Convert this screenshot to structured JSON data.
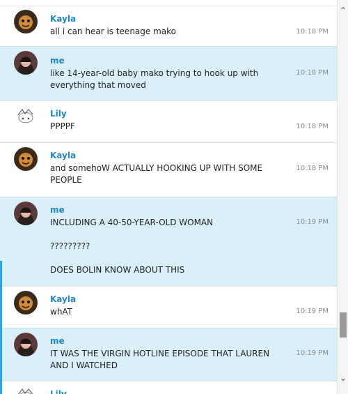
{
  "messages": [
    {
      "sender": "Kayla",
      "lines": [
        "all i can hear is teenage mako"
      ],
      "time": "10:18 PM",
      "self": false
    },
    {
      "sender": "me",
      "lines": [
        "like 14-year-old baby mako trying to hook up with everything that moved"
      ],
      "time": "10:18 PM",
      "self": true
    },
    {
      "sender": "Lily",
      "lines": [
        "PPPPF"
      ],
      "time": "10:18 PM",
      "self": false
    },
    {
      "sender": "Kayla",
      "lines": [
        "and somehoW ACTUALLY HOOKING UP WITH SOME PEOPLE"
      ],
      "time": "10:18 PM",
      "self": false
    },
    {
      "sender": "me",
      "lines": [
        "INCLUDING A 40-50-YEAR-OLD WOMAN",
        "?????????",
        "DOES BOLIN KNOW ABOUT THIS"
      ],
      "time": "10:19 PM",
      "self": true
    },
    {
      "sender": "Kayla",
      "lines": [
        "whAT"
      ],
      "time": "10:19 PM",
      "self": false
    },
    {
      "sender": "me",
      "lines": [
        "IT WAS THE VIRGIN HOTLINE EPISODE THAT LAUREN AND I WATCHED"
      ],
      "time": "10:19 PM",
      "self": true
    },
    {
      "sender": "Lily",
      "lines": [],
      "time": "",
      "self": false
    }
  ],
  "avatars": {
    "Kayla": {
      "icon": "kayla-avatar-icon",
      "bg": "#3a2a1a",
      "face": "#d08a3a"
    },
    "me": {
      "icon": "me-avatar-icon",
      "bg": "#5a3a3a",
      "face": "#e8b8a8"
    },
    "Lily": {
      "icon": "lily-avatar-icon",
      "bg": "#ffffff",
      "face": "#f4f4f4"
    }
  },
  "scrollbar": {
    "up_icon": "chevron-up-icon",
    "down_icon": "chevron-down-icon"
  }
}
